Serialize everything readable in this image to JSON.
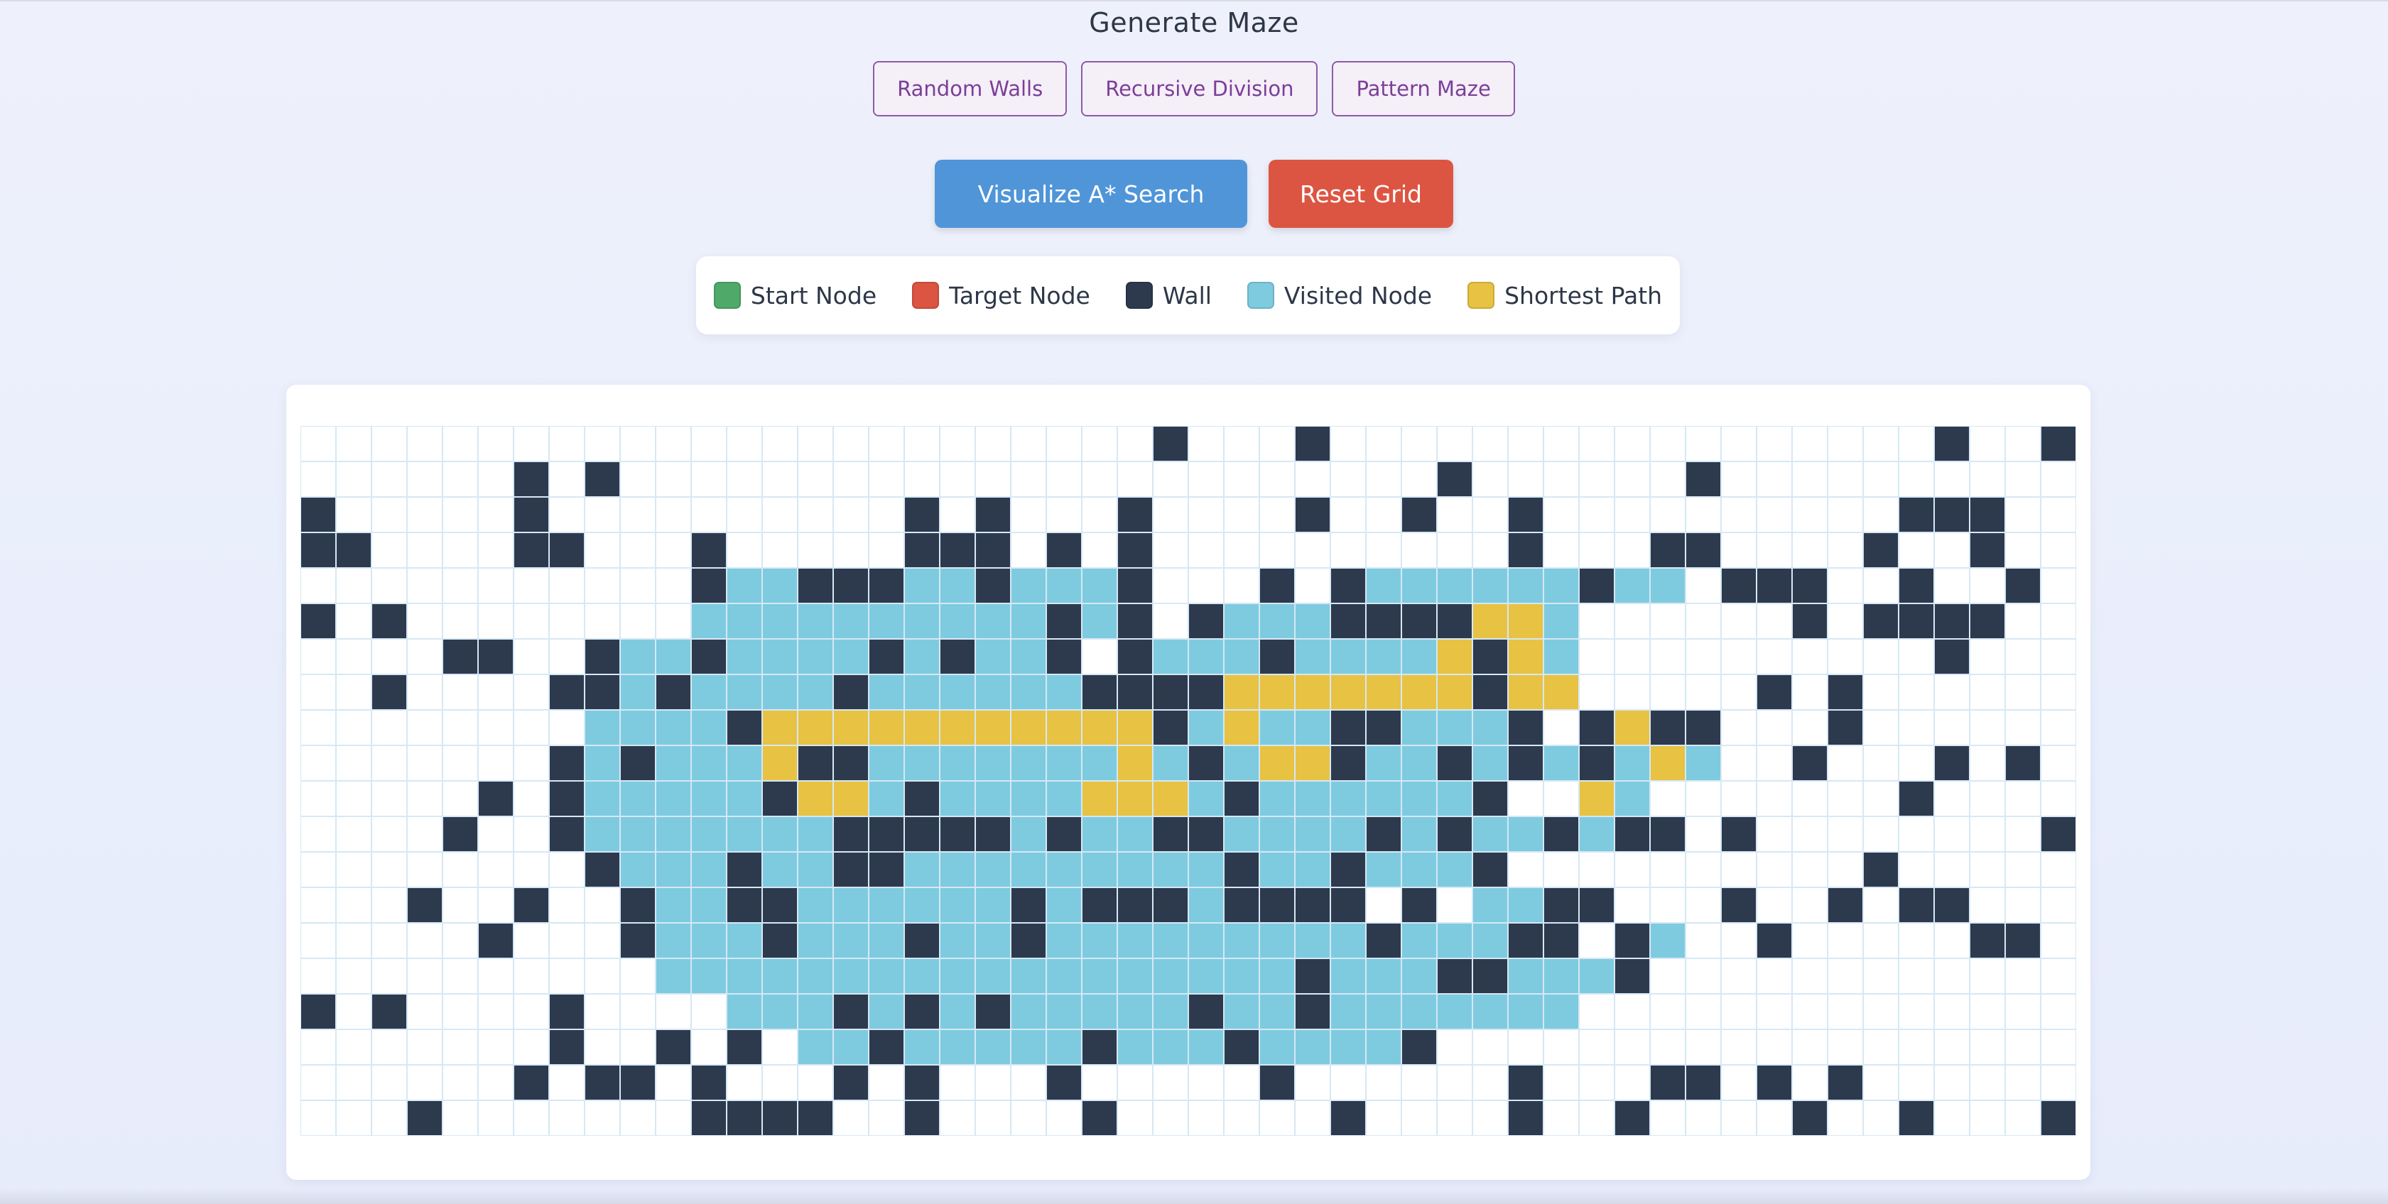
{
  "page": {
    "title": "Generate Maze"
  },
  "maze_buttons": [
    {
      "label": "Random Walls"
    },
    {
      "label": "Recursive Division"
    },
    {
      "label": "Pattern Maze"
    }
  ],
  "actions": {
    "visualize_label": "Visualize A* Search",
    "reset_label": "Reset Grid"
  },
  "legend": [
    {
      "label": "Start Node",
      "color": "#4faa6a"
    },
    {
      "label": "Target Node",
      "color": "#dc5542"
    },
    {
      "label": "Wall",
      "color": "#2d3a4e"
    },
    {
      "label": "Visited Node",
      "color": "#7ecbe0"
    },
    {
      "label": "Shortest Path",
      "color": "#e8c242"
    }
  ],
  "grid": {
    "rows": 20,
    "cols": 50,
    "colors": {
      "empty": "#ffffff",
      "wall": "#2d3a4e",
      "visited": "#7ecbe0",
      "path": "#e8c242",
      "border": "#d6e8f5"
    },
    "cells": [
      "........................#...#.................#..##....#.....#",
      "......#.#.......................#......#..................#...",
      "#.....#..........#.#...#....#..#..#..........###..#...........",
      "##....##...#.....###.#.#..........#...##....#..#..............",
      "...........#VV###VV#VVV#...#.#VVVVVV#VV.###..#..#.............",
      "#.#........VVVVVVVVVV#V#.#VVV####PPV......#.####..............",
      "....##..#VV#VVVV#V#VV#.#VVV#VVVVP#PV..........#...............",
      "..#....##V#VVVV#VVVVVV####PPPPPPP#PP.....#.#..................",
      "........VVVV#PPPPPPPPPPP#VPVV##VVV#.#P##...#..................#",
      ".......#V#VVVP##VVVVVVVPV#VPP#VV#V#V#VPV..#...#.#.............",
      ".....#.#VVVVV#PPV#VVVVPPPV#VVVVVV#..PV.......#.............#",
      "....#..#VVVVVVV#####V#VV##VVVV#V#VV#V##.#........##...........",
      "........#VVV#VV##VVVVVVVVV#VV#VVV#..........#..................##",
      "...#..#..#VV##VVVVVV#V###V####.#.VV##...#..#.##..............",
      ".....#...#VVV#VVV#VV#VVVVVVVVV#VVV##.#V..#.....##.........",
      "..........VVVVVVVVVVVVVVVVVV#VVV##VVV#..........................",
      "#.#....#....VVV#V#V#VVVVV#VV#VVVVVVV......................#.....",
      ".......#..#.#.VV#VVVVV#VVV#VVVV#..................#....##.......",
      "......#.##.#...#.#...#.....#......#...##.#.#....................#",
      "...#.......####..#....#......#....#..#....#..#...#.............##"
    ]
  }
}
